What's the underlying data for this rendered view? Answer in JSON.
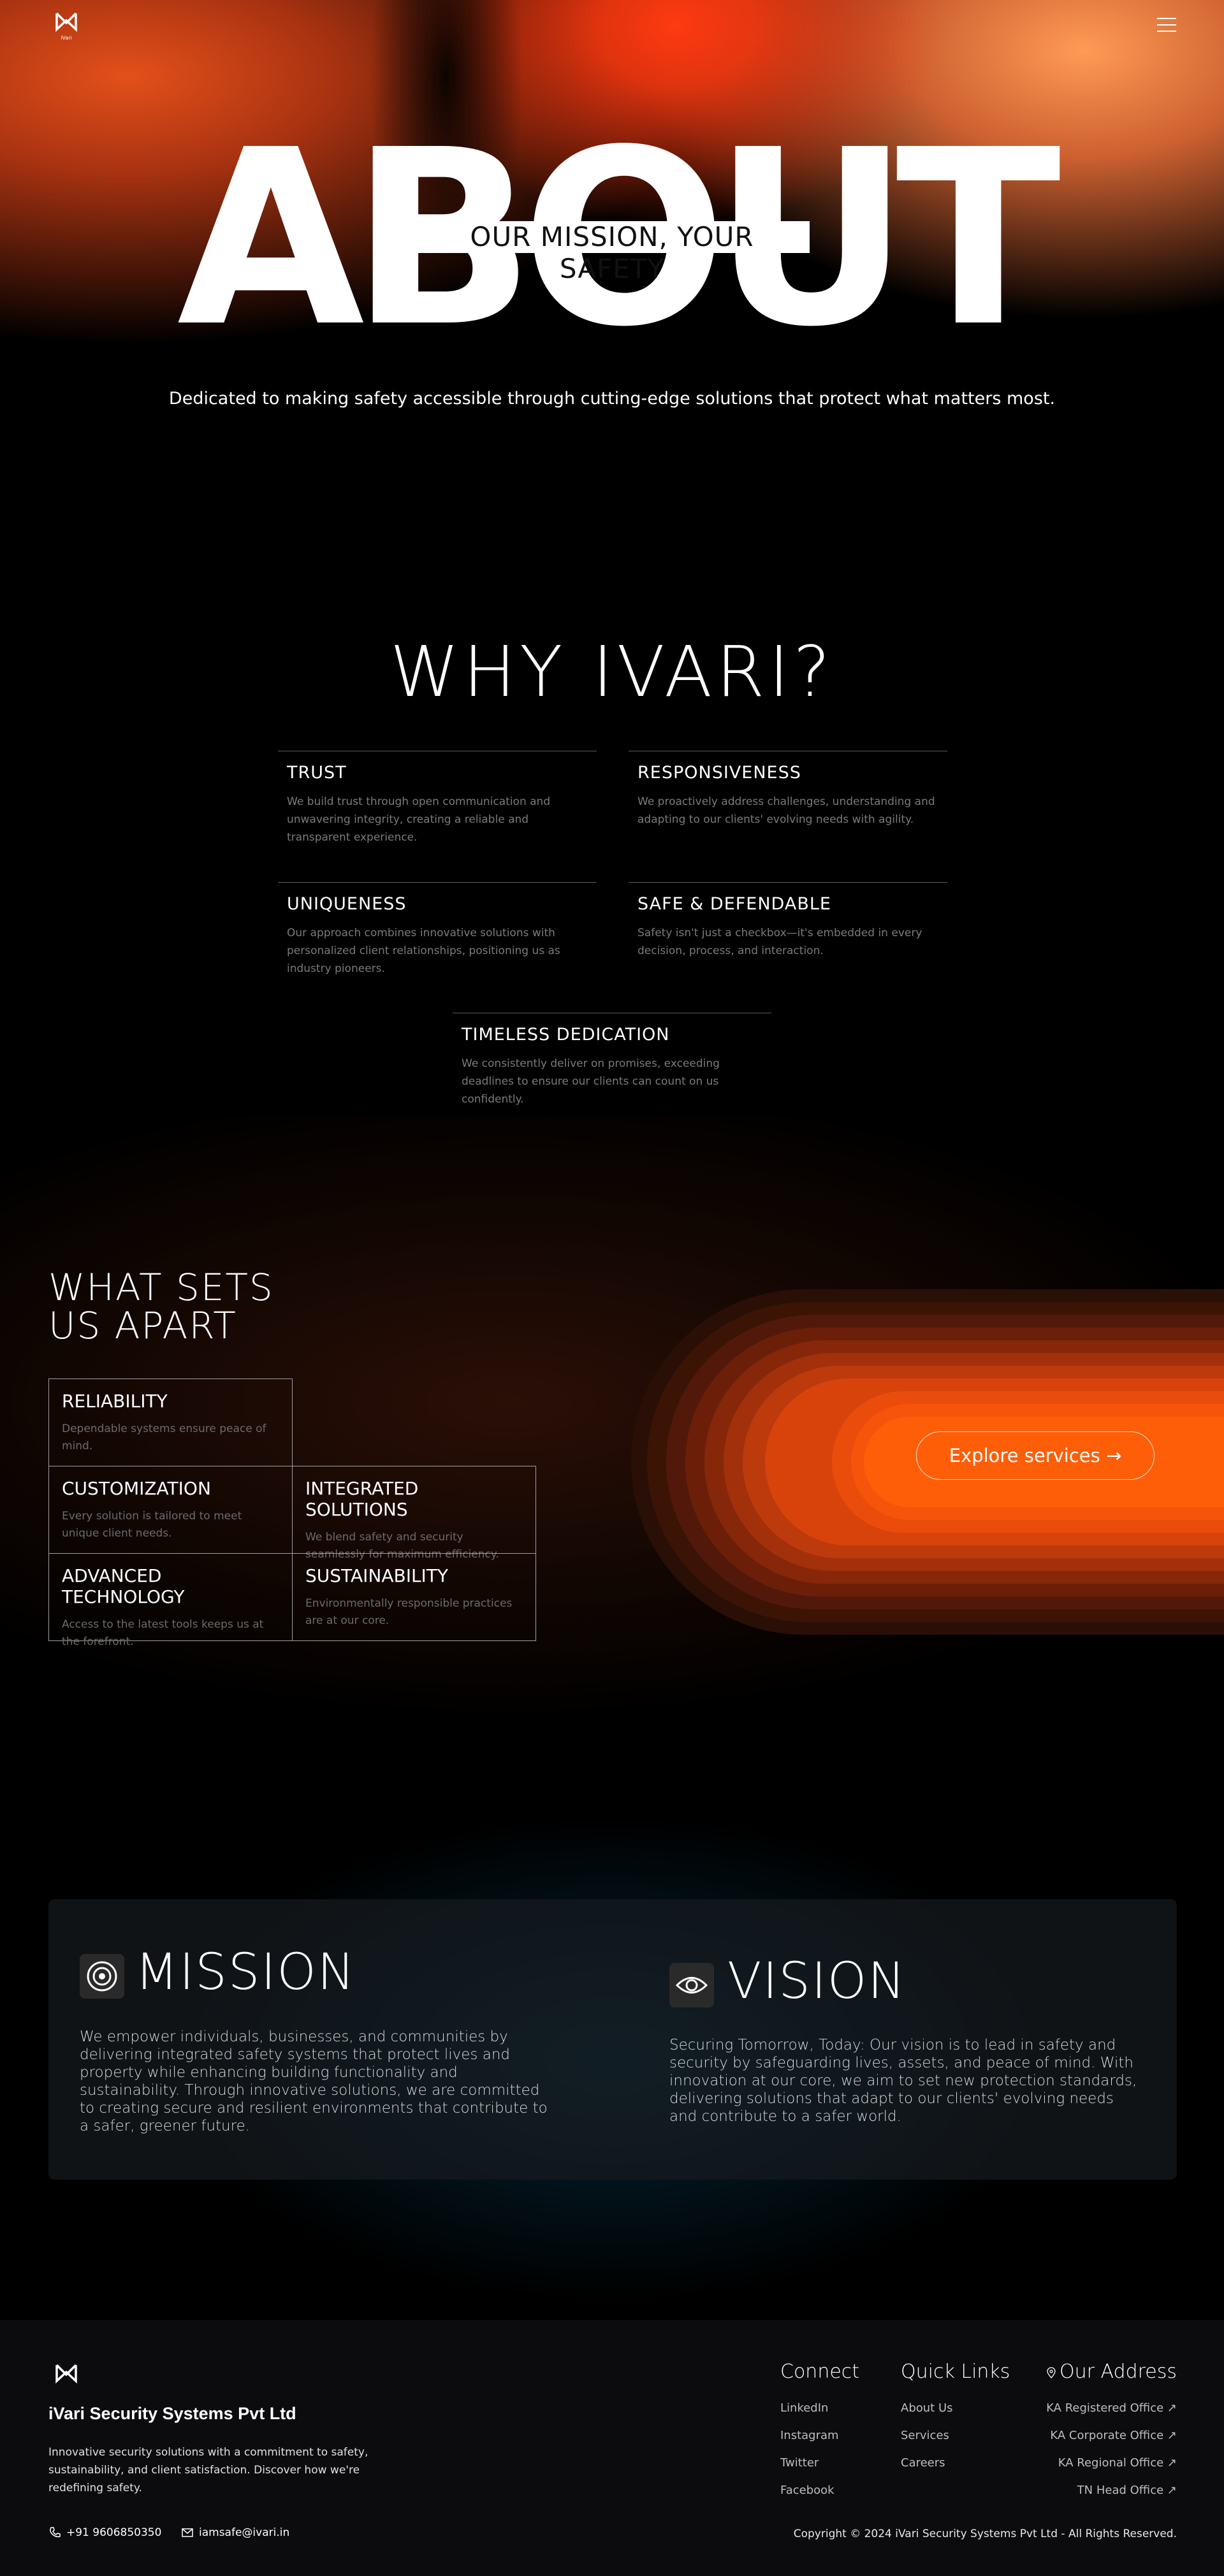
{
  "header": {
    "logo_icon": "ivari-logo-icon",
    "logo_caption": "iVari",
    "menu_icon": "hamburger-menu-icon"
  },
  "hero": {
    "big_word": "ABOUT",
    "tagline": "OUR MISSION, YOUR SAFETY",
    "subtitle": "Dedicated to making safety accessible through cutting-edge solutions that protect what matters most."
  },
  "why": {
    "title": "WHY IVARI?",
    "cards": [
      {
        "title": "TRUST",
        "text": "We build trust through open communication and unwavering integrity, creating a reliable and transparent experience."
      },
      {
        "title": "RESPONSIVENESS",
        "text": "We proactively address challenges, understanding and adapting to our clients' evolving needs with agility."
      },
      {
        "title": "UNIQUENESS",
        "text": "Our approach combines innovative solutions with personalized client relationships, positioning us as industry pioneers."
      },
      {
        "title": "SAFE & DEFENDABLE",
        "text": "Safety isn't just a checkbox—it's embedded in every decision, process, and interaction."
      },
      {
        "title": "TIMELESS DEDICATION",
        "text": "We consistently deliver on promises, exceeding deadlines to ensure our clients can count on us confidently."
      }
    ]
  },
  "apart": {
    "title_line1": "WHAT SETS",
    "title_line2": "US APART",
    "cells": [
      {
        "title": "RELIABILITY",
        "text": "Dependable systems ensure peace of mind."
      },
      {
        "title": "CUSTOMIZATION",
        "text": "Every solution is tailored to meet unique client needs."
      },
      {
        "title": "INTEGRATED SOLUTIONS",
        "text": "We blend safety and security seamlessly for maximum efficiency."
      },
      {
        "title": "ADVANCED TECHNOLOGY",
        "text": "Access to the latest tools keeps us at the forefront."
      },
      {
        "title": "SUSTAINABILITY",
        "text": "Environmentally responsible practices are at our core."
      }
    ],
    "explore_label": "Explore services",
    "explore_arrow": "→"
  },
  "mission": {
    "icon": "target-icon",
    "title": "MISSION",
    "text": "We empower individuals, businesses, and communities by delivering integrated safety systems that protect lives and property while enhancing building functionality and sustainability. Through innovative solutions, we are committed to creating secure and resilient environments that contribute to a safer, greener future."
  },
  "vision": {
    "icon": "eye-icon",
    "title": "VISION",
    "text": "Securing Tomorrow, Today: Our vision is to lead in safety and security by safeguarding lives, assets, and peace of mind. With innovation at our core, we aim to set new protection standards, delivering solutions that adapt to our clients' evolving needs and contribute to a safer world."
  },
  "footer": {
    "company": "iVari Security Systems Pvt Ltd",
    "description": "Innovative security solutions with a commitment to safety, sustainability, and client satisfaction. Discover how we're redefining safety.",
    "phone": "+91 9606850350",
    "email": "iamsafe@ivari.in",
    "connect_heading": "Connect",
    "connect_links": [
      "LinkedIn",
      "Instagram",
      "Twitter",
      "Facebook"
    ],
    "quick_heading": "Quick Links",
    "quick_links": [
      "About Us",
      "Services",
      "Careers"
    ],
    "address_heading": "Our Address",
    "address_links": [
      "KA Registered Office",
      "KA Corporate Office",
      "KA Regional Office",
      "TN Head Office"
    ],
    "external_arrow": "↗",
    "copyright": "Copyright © 2024 iVari Security Systems Pvt Ltd - All Rights Reserved."
  }
}
